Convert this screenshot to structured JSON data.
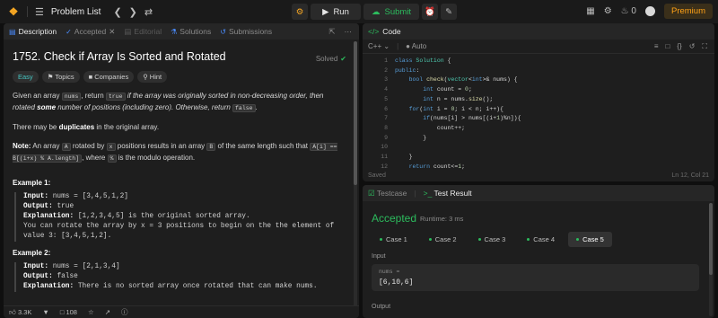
{
  "topbar": {
    "title": "Problem List",
    "run_label": "Run",
    "submit_label": "Submit",
    "streak_count": "0",
    "premium_label": "Premium"
  },
  "left": {
    "tabs": [
      "Description",
      "Accepted",
      "Editorial",
      "Solutions",
      "Submissions"
    ],
    "problem_title": "1752. Check if Array Is Sorted and Rotated",
    "solved_label": "Solved",
    "chips": [
      "Easy",
      "Topics",
      "Companies",
      "Hint"
    ],
    "para1_a": "Given an array ",
    "para1_code1": "nums",
    "para1_b": ", return ",
    "para1_code2": "true",
    "para1_c": " if the array was originally sorted in non-decreasing order, then rotated ",
    "para1_d": "some",
    "para1_e": " number of positions (including zero). Otherwise, return ",
    "para1_code3": "false",
    "para1_f": ".",
    "para2_a": "There may be ",
    "para2_b": "duplicates",
    "para2_c": " in the original array.",
    "note_label": "Note:",
    "note_a": " An array ",
    "note_code1": "A",
    "note_b": " rotated by ",
    "note_code2": "x",
    "note_c": " positions results in an array ",
    "note_code3": "B",
    "note_d": " of the same length such that ",
    "note_code4": "A[i] == B[(i+x) % A.length]",
    "note_e": ", where ",
    "note_code5": "%",
    "note_f": " is the modulo operation.",
    "ex1_title": "Example 1:",
    "ex1_input_label": "Input:",
    "ex1_input": " nums = [3,4,5,1,2]",
    "ex1_output_label": "Output:",
    "ex1_output": " true",
    "ex1_expl_label": "Explanation:",
    "ex1_expl1": " [1,2,3,4,5] is the original sorted array.",
    "ex1_expl2": "You can rotate the array by x = 3 positions to begin on the the element of",
    "ex1_expl3": "value 3: [3,4,5,1,2].",
    "ex2_title": "Example 2:",
    "ex2_input_label": "Input:",
    "ex2_input": " nums = [2,1,3,4]",
    "ex2_output_label": "Output:",
    "ex2_output": " false",
    "ex2_expl_label": "Explanation:",
    "ex2_expl": " There is no sorted array once rotated that can make nums.",
    "likes": "3.3K",
    "comments": "108"
  },
  "code": {
    "tab_label": "Code",
    "language": "C++",
    "mode": "Auto",
    "status_left": "Saved",
    "status_right": "Ln 12, Col 21",
    "lines": [
      "class Solution {",
      "public:",
      "    bool check(vector<int>& nums) {",
      "        int count = 0;",
      "        int n = nums.size();",
      "    for(int i = 0; i < n; i++){",
      "        if(nums[i] > nums[(i+1)%n]){",
      "            count++;",
      "        }",
      "",
      "    }",
      "    return count<=1;"
    ]
  },
  "result": {
    "tab_testcase": "Testcase",
    "tab_result": "Test Result",
    "status": "Accepted",
    "runtime": "Runtime: 3 ms",
    "cases": [
      "Case 1",
      "Case 2",
      "Case 3",
      "Case 4",
      "Case 5"
    ],
    "active_case": 4,
    "input_label": "Input",
    "input_name": "nums =",
    "input_value": "[6,10,6]",
    "output_label": "Output"
  }
}
